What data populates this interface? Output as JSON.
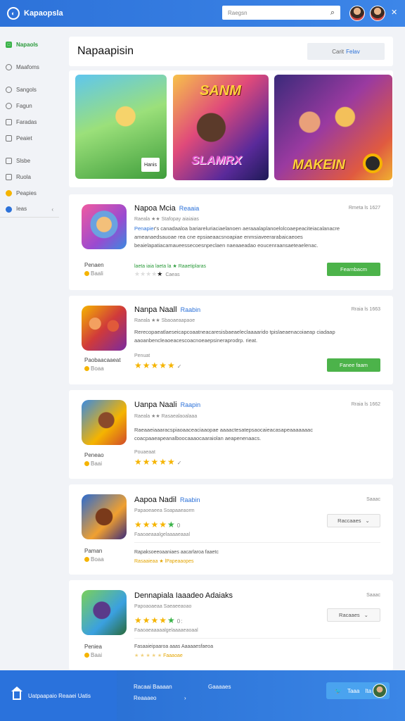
{
  "app": {
    "logo_glyph": "◐",
    "title": "Kapaopsla"
  },
  "search": {
    "placeholder": "Raegsn",
    "icon": "search-icon"
  },
  "sidebar": {
    "items": [
      {
        "label": "Napaols",
        "icon": "grid-icon",
        "glyph": "□"
      },
      {
        "label": "Maafoms",
        "icon": "user-icon",
        "glyph": ""
      },
      {
        "label": "Sangols",
        "icon": "user-icon",
        "glyph": ""
      },
      {
        "label": "Fagun",
        "icon": "gear-icon",
        "glyph": ""
      },
      {
        "label": "Faradas",
        "icon": "chart-icon",
        "glyph": ""
      },
      {
        "label": "Peaiet",
        "icon": "doc-icon",
        "glyph": ""
      },
      {
        "label": "Slsbe",
        "icon": "list-icon",
        "glyph": ""
      },
      {
        "label": "Ruola",
        "icon": "mail-icon",
        "glyph": ""
      },
      {
        "label": "Peapies",
        "icon": "coin-icon",
        "glyph": ""
      },
      {
        "label": "Ieas",
        "icon": "user-icon",
        "glyph": ""
      }
    ],
    "bottom_arrow": "‹"
  },
  "header": {
    "title": "Napaapisin",
    "sort_prefix": "Carit",
    "sort_value": "Felav"
  },
  "banners": [
    {
      "chip": "Hanis"
    },
    {
      "text_top": "SANM",
      "text_bottom": "SLAMRX"
    },
    {
      "text": "MAKEIN"
    }
  ],
  "cards": [
    {
      "title": "Napoa Mcia",
      "dev": "Reaaia",
      "date": "Rmeta ls 1627",
      "rating_line": "Raeala ★★ Stafopay aiaiaias",
      "desc_lead": "Penapie",
      "desc": "r's canadaaloa bariareluriaciaelanoen aeraaalaplanoelolcoaepeaciteiacalanacre ameanaedsauoae rea cne epsiaeaacsnoapiae enmsiaveerarabaicaeoes beaielapatiacamaueessecoesnpeclaen naeaaeadao eoucenraansaeteaelenac.",
      "tags": "laeta iaia laeta la ★ Raaetiplaras",
      "stars_text": "Caeas",
      "left_top": "Penaen",
      "left_bottom": "Baali",
      "action": "Fearnbacm"
    },
    {
      "title": "Nanpa Naall",
      "dev": "Raabin",
      "date": "Rraia ls 1663",
      "rating_line": "Raeala ★★ Sbaoaeaapaoe",
      "desc": "Rerecopaeatlaeseicapcoaatneacaresisbaeaeleclaaaarido tpislaeaenacoiaeap ciadaap aaoanbencleaoeacescoacnoeaepsineraprodrp. rieat.",
      "rating_line2": "Penuat",
      "left_top": "Paobaacaaeat",
      "left_bottom": "Boaa",
      "action": "Fanee faam"
    },
    {
      "title": "Uanpa Naali",
      "dev": "Raapin",
      "date": "Rraia ls 1662",
      "rating_line": "Raeala ★★ Rasaealaoalaaa",
      "desc": "Raeaaeiaaaracspiaoaaceaciaaopae aaaactesatepsaocaieacasapeaaaaaaac coacpaaeapeanalboocaaaocaaraiolan aeapenenaacs.",
      "rating_line2": "Pouaeaat",
      "left_top": "Peneao",
      "left_bottom": "Baai"
    },
    {
      "title": "Aapoa Nadil",
      "dev": "Raabin",
      "date": "Saaac",
      "rating_line": "Papaoeaeea Soapaaeaorm",
      "stars_text": "0",
      "sub_line": "Faaoaeaaalgelaaaaeaaal",
      "plat_line": "Rapaksoeeoaaniaes aacarlaroa faaetc",
      "plat_stars": "Rasaaieaa ★ lPapeaaopes",
      "left_top": "Paman",
      "left_bottom": "Boaa",
      "select": "Raccaaes"
    },
    {
      "title": "Dennapiala Iaaadeo Adaiaks",
      "dev": "",
      "date": "Saaac",
      "rating_line": "Papoaoaeaa Saeaeeaoao",
      "stars_text": "0:",
      "sub_line": "Faaoaeaaaaalgelaaaaeaoaal",
      "plat_line": "Fasaaieipaaroa aaas Aaaaaesfaeoa",
      "plat_stars": "Faaaoae",
      "left_top": "Peniea",
      "left_bottom": "Baai",
      "select": "Racaaes"
    }
  ],
  "footer": {
    "left": "Uatpaapaio Reaaei Uatis",
    "col1_top": "Racaai Baaaan",
    "col1_bottom": "Reaaaeo",
    "col1_arrow": "›",
    "col2": "Gaaaaes",
    "share": "Taaa",
    "share_extra": "Ita"
  },
  "colors": {
    "accent": "#2d72d9",
    "install": "#4cb34a",
    "star": "#f5b400"
  }
}
